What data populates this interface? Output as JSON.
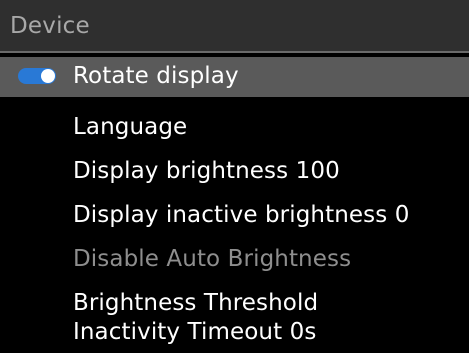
{
  "header": {
    "title": "Device"
  },
  "menu": {
    "items": [
      {
        "label": "Rotate display",
        "selected": true,
        "toggle_on": true
      },
      {
        "label": "Language"
      },
      {
        "label": "Display brightness 100"
      },
      {
        "label": "Display inactive brightness 0"
      },
      {
        "label": "Disable Auto Brightness",
        "disabled": true
      },
      {
        "label": "Brightness Threshold"
      },
      {
        "label": "Inactivity Timeout 0s"
      }
    ]
  },
  "colors": {
    "background": "#000000",
    "header_background": "#2f2f2f",
    "selected_row": "#5a5a5a",
    "toggle_accent": "#2979d6",
    "disabled_text": "#8e8e8e"
  }
}
